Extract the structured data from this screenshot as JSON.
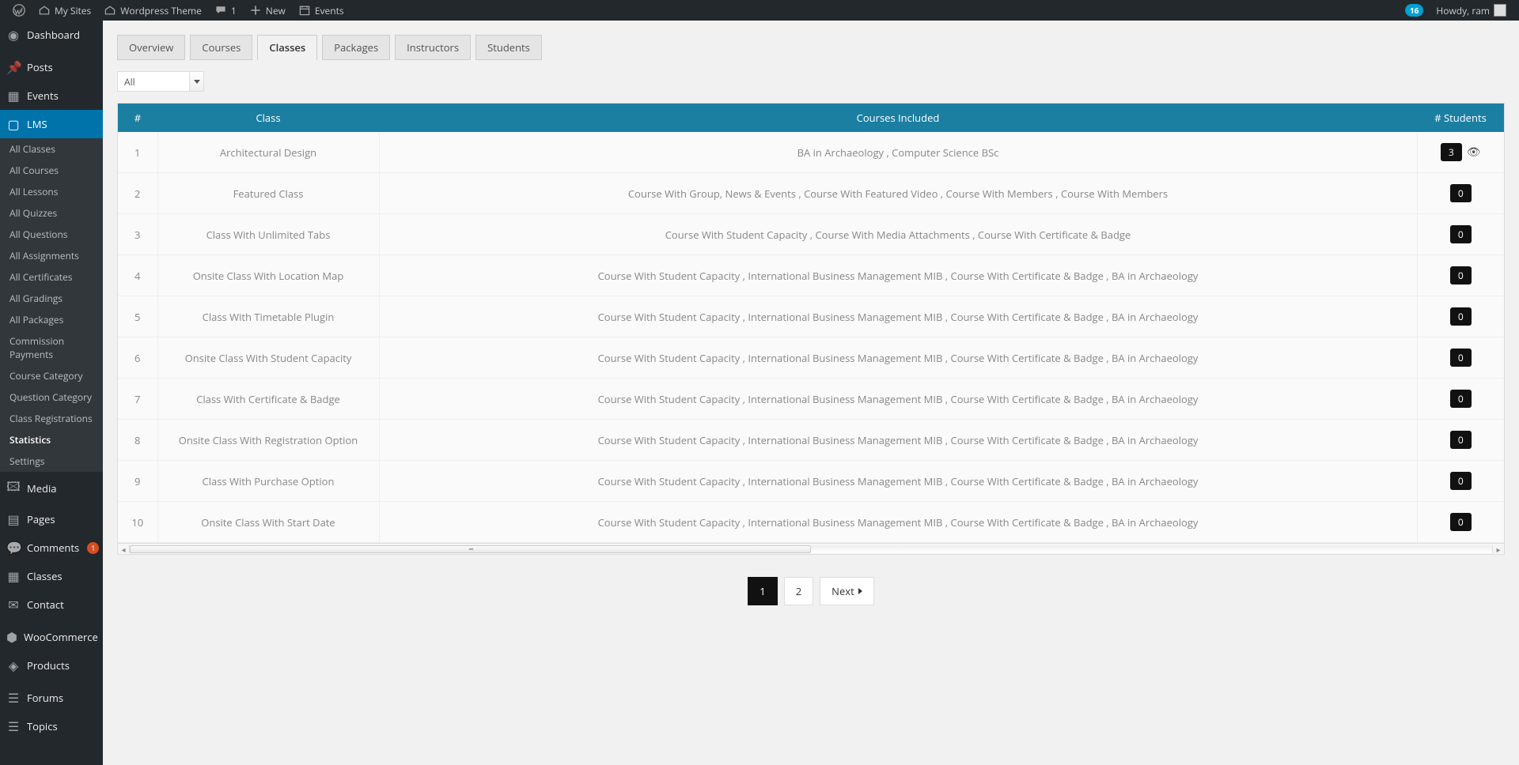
{
  "adminbar": {
    "my_sites": "My Sites",
    "site_name": "Wordpress Theme",
    "comments": "1",
    "new": "New",
    "events": "Events",
    "updates_count": "16",
    "howdy": "Howdy, ram"
  },
  "sidebar": {
    "dashboard": "Dashboard",
    "posts": "Posts",
    "events": "Events",
    "lms": "LMS",
    "lms_sub": [
      "All Classes",
      "All Courses",
      "All Lessons",
      "All Quizzes",
      "All Questions",
      "All Assignments",
      "All Certificates",
      "All Gradings",
      "All Packages",
      "Commission Payments",
      "Course Category",
      "Question Category",
      "Class Registrations",
      "Statistics",
      "Settings"
    ],
    "lms_sub_current": "Statistics",
    "media": "Media",
    "pages": "Pages",
    "comments": "Comments",
    "comments_count": "1",
    "classes": "Classes",
    "contact": "Contact",
    "woocommerce": "WooCommerce",
    "products": "Products",
    "forums": "Forums",
    "topics": "Topics"
  },
  "tabs": [
    "Overview",
    "Courses",
    "Classes",
    "Packages",
    "Instructors",
    "Students"
  ],
  "active_tab": "Classes",
  "filter": {
    "selected": "All"
  },
  "table": {
    "headers": {
      "index": "#",
      "class": "Class",
      "courses": "Courses Included",
      "students": "# Students"
    },
    "rows": [
      {
        "idx": "1",
        "class": "Architectural Design",
        "courses": [
          "BA in Archaeology",
          "Computer Science BSc"
        ],
        "students": "3",
        "has_view": true
      },
      {
        "idx": "2",
        "class": "Featured Class",
        "courses": [
          "Course With Group, News & Events",
          "Course With Featured Video",
          "Course With Members",
          "Course With Members"
        ],
        "students": "0",
        "has_view": false
      },
      {
        "idx": "3",
        "class": "Class With Unlimited Tabs",
        "courses": [
          "Course With Student Capacity",
          "Course With Media Attachments",
          "Course With Certificate & Badge"
        ],
        "students": "0",
        "has_view": false
      },
      {
        "idx": "4",
        "class": "Onsite Class With Location Map",
        "courses": [
          "Course With Student Capacity",
          "International Business Management MIB",
          "Course With Certificate & Badge",
          "BA in Archaeology"
        ],
        "students": "0",
        "has_view": false
      },
      {
        "idx": "5",
        "class": "Class With Timetable Plugin",
        "courses": [
          "Course With Student Capacity",
          "International Business Management MIB",
          "Course With Certificate & Badge",
          "BA in Archaeology"
        ],
        "students": "0",
        "has_view": false
      },
      {
        "idx": "6",
        "class": "Onsite Class With Student Capacity",
        "courses": [
          "Course With Student Capacity",
          "International Business Management MIB",
          "Course With Certificate & Badge",
          "BA in Archaeology"
        ],
        "students": "0",
        "has_view": false
      },
      {
        "idx": "7",
        "class": "Class With Certificate & Badge",
        "courses": [
          "Course With Student Capacity",
          "International Business Management MIB",
          "Course With Certificate & Badge",
          "BA in Archaeology"
        ],
        "students": "0",
        "has_view": false
      },
      {
        "idx": "8",
        "class": "Onsite Class With Registration Option",
        "courses": [
          "Course With Student Capacity",
          "International Business Management MIB",
          "Course With Certificate & Badge",
          "BA in Archaeology"
        ],
        "students": "0",
        "has_view": false
      },
      {
        "idx": "9",
        "class": "Class With Purchase Option",
        "courses": [
          "Course With Student Capacity",
          "International Business Management MIB",
          "Course With Certificate & Badge",
          "BA in Archaeology"
        ],
        "students": "0",
        "has_view": false
      },
      {
        "idx": "10",
        "class": "Onsite Class With Start Date",
        "courses": [
          "Course With Student Capacity",
          "International Business Management MIB",
          "Course With Certificate & Badge",
          "BA in Archaeology"
        ],
        "students": "0",
        "has_view": false
      }
    ]
  },
  "pagination": {
    "pages": [
      "1",
      "2"
    ],
    "active": "1",
    "next": "Next"
  }
}
